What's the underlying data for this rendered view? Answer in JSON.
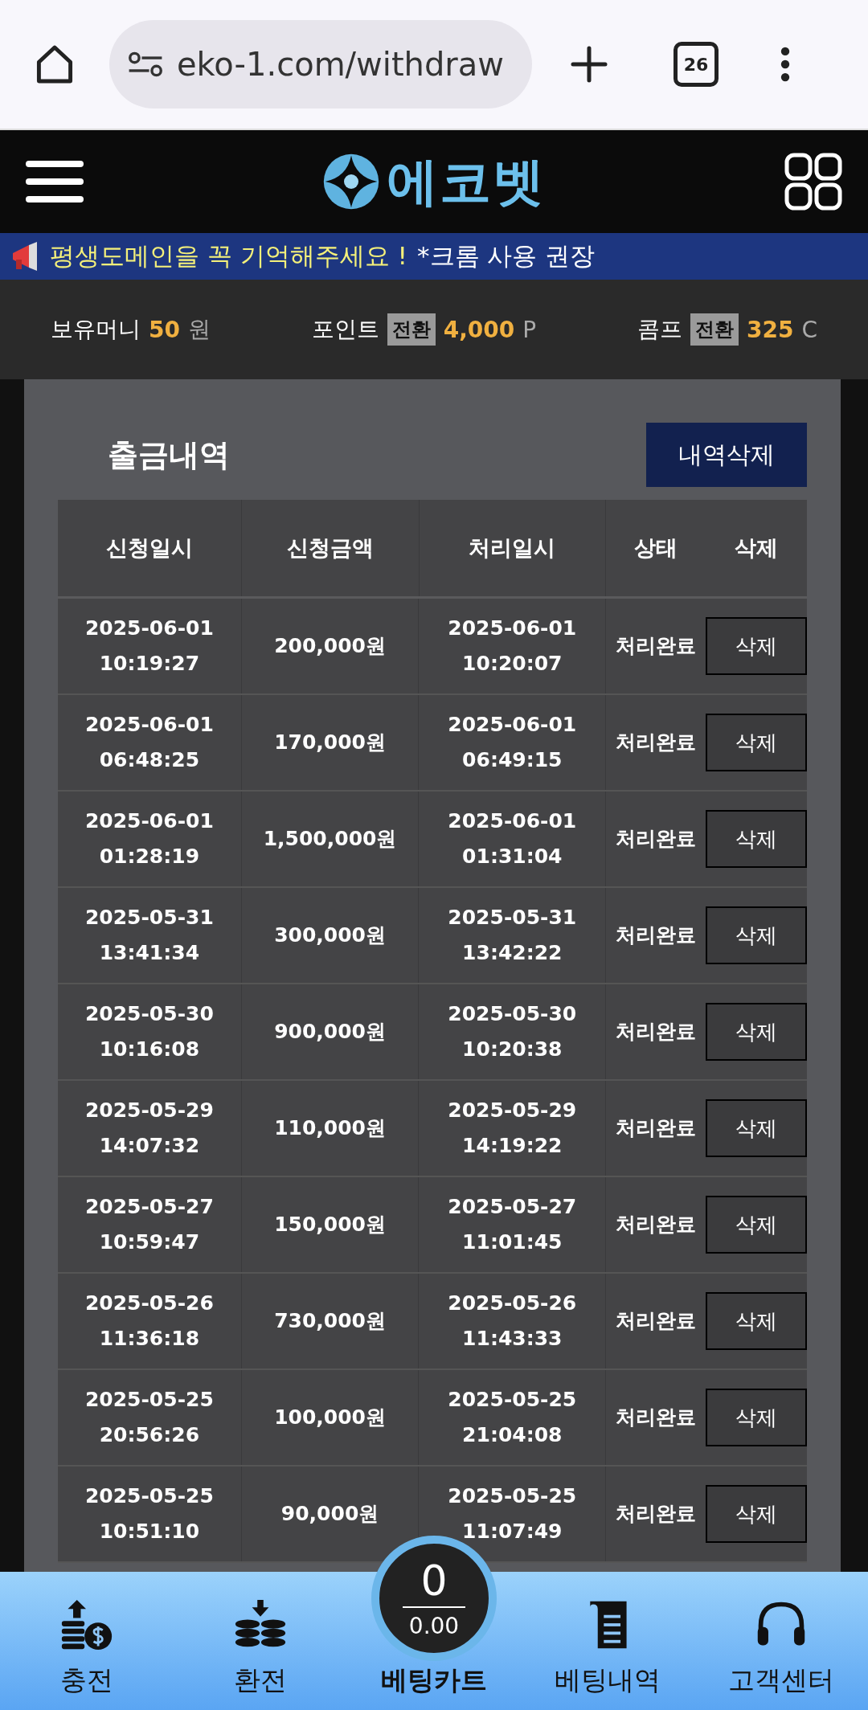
{
  "browser": {
    "url": "eko-1.com/withdraw",
    "tab_count": "26"
  },
  "header": {
    "logo": "에코벳"
  },
  "notice": {
    "highlight": "평생도메인을 꼭 기억해주세요 !",
    "rest": "*크롬 사용 권장"
  },
  "balances": [
    {
      "label": "보유머니",
      "value": "50",
      "unit": "원"
    },
    {
      "label": "포인트",
      "button": "전환",
      "value": "4,000",
      "unit": "P"
    },
    {
      "label": "콤프",
      "button": "전환",
      "value": "325",
      "unit": "C"
    }
  ],
  "section": {
    "title": "출금내역",
    "delete_all_button": "내역삭제"
  },
  "table": {
    "columns": [
      "신청일시",
      "신청금액",
      "처리일시",
      "상태",
      "삭제"
    ],
    "rows": [
      {
        "requested_date": "2025-06-01",
        "requested_time": "10:19:27",
        "amount": "200,000원",
        "processed_date": "2025-06-01",
        "processed_time": "10:20:07",
        "status": "처리완료",
        "delete": "삭제"
      },
      {
        "requested_date": "2025-06-01",
        "requested_time": "06:48:25",
        "amount": "170,000원",
        "processed_date": "2025-06-01",
        "processed_time": "06:49:15",
        "status": "처리완료",
        "delete": "삭제"
      },
      {
        "requested_date": "2025-06-01",
        "requested_time": "01:28:19",
        "amount": "1,500,000원",
        "processed_date": "2025-06-01",
        "processed_time": "01:31:04",
        "status": "처리완료",
        "delete": "삭제"
      },
      {
        "requested_date": "2025-05-31",
        "requested_time": "13:41:34",
        "amount": "300,000원",
        "processed_date": "2025-05-31",
        "processed_time": "13:42:22",
        "status": "처리완료",
        "delete": "삭제"
      },
      {
        "requested_date": "2025-05-30",
        "requested_time": "10:16:08",
        "amount": "900,000원",
        "processed_date": "2025-05-30",
        "processed_time": "10:20:38",
        "status": "처리완료",
        "delete": "삭제"
      },
      {
        "requested_date": "2025-05-29",
        "requested_time": "14:07:32",
        "amount": "110,000원",
        "processed_date": "2025-05-29",
        "processed_time": "14:19:22",
        "status": "처리완료",
        "delete": "삭제"
      },
      {
        "requested_date": "2025-05-27",
        "requested_time": "10:59:47",
        "amount": "150,000원",
        "processed_date": "2025-05-27",
        "processed_time": "11:01:45",
        "status": "처리완료",
        "delete": "삭제"
      },
      {
        "requested_date": "2025-05-26",
        "requested_time": "11:36:18",
        "amount": "730,000원",
        "processed_date": "2025-05-26",
        "processed_time": "11:43:33",
        "status": "처리완료",
        "delete": "삭제"
      },
      {
        "requested_date": "2025-05-25",
        "requested_time": "20:56:26",
        "amount": "100,000원",
        "processed_date": "2025-05-25",
        "processed_time": "21:04:08",
        "status": "처리완료",
        "delete": "삭제"
      },
      {
        "requested_date": "2025-05-25",
        "requested_time": "10:51:10",
        "amount": "90,000원",
        "processed_date": "2025-05-25",
        "processed_time": "11:07:49",
        "status": "처리완료",
        "delete": "삭제"
      }
    ]
  },
  "bottom_nav": {
    "items": [
      {
        "kind": "deposit",
        "label": "충전"
      },
      {
        "kind": "exchange",
        "label": "환전"
      },
      {
        "kind": "cart",
        "label": "베팅카트",
        "count": "0",
        "amount": "0.00"
      },
      {
        "kind": "history",
        "label": "베팅내역"
      },
      {
        "kind": "support",
        "label": "고객센터"
      }
    ]
  }
}
